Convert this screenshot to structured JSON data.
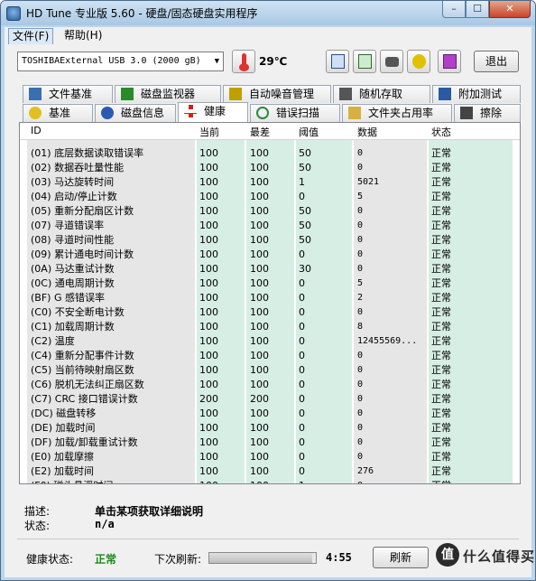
{
  "window": {
    "title": "HD Tune 专业版 5.60 - 硬盘/固态硬盘实用程序",
    "min": "–",
    "max": "☐",
    "close": "✕"
  },
  "menu": {
    "file": "文件(F)",
    "help": "帮助(H)"
  },
  "toolbar": {
    "drive": "TOSHIBAExternal USB 3.0 (2000 gB)",
    "temperature": "29℃",
    "exit": "退出",
    "icons": [
      "copy-icon",
      "copy-all-icon",
      "camera-icon",
      "tools-icon",
      "download-icon"
    ]
  },
  "tabs_row1": [
    {
      "label": "文件基准",
      "icon": "file-benchmark-icon",
      "color": "#3a6fb0"
    },
    {
      "label": "磁盘监视器",
      "icon": "disk-monitor-icon",
      "color": "#2a8a2a"
    },
    {
      "label": "自动噪音管理",
      "icon": "speaker-icon",
      "color": "#c0a000"
    },
    {
      "label": "随机存取",
      "icon": "random-access-icon",
      "color": "#555555"
    },
    {
      "label": "附加测试",
      "icon": "extra-tests-icon",
      "color": "#2a5aa0"
    }
  ],
  "tabs_row2": [
    {
      "label": "基准",
      "icon": "lightbulb-icon",
      "color": "#e0c020"
    },
    {
      "label": "磁盘信息",
      "icon": "info-icon",
      "color": "#2a5ab0"
    },
    {
      "label": "健康",
      "icon": "health-cross-icon",
      "color": "#d02020"
    },
    {
      "label": "错误扫描",
      "icon": "magnifier-icon",
      "color": "#2a8a3a"
    },
    {
      "label": "文件夹占用率",
      "icon": "folder-icon",
      "color": "#d8b040"
    },
    {
      "label": "擦除",
      "icon": "trash-icon",
      "color": "#444444"
    }
  ],
  "active_tab": "健康",
  "table": {
    "headers": {
      "id": "ID",
      "current": "当前",
      "worst": "最差",
      "threshold": "阈值",
      "data": "数据",
      "status": "状态"
    },
    "rows": [
      {
        "id": "(01) 底层数据读取错误率",
        "cur": "100",
        "worst": "100",
        "thr": "50",
        "data": "0",
        "status": "正常"
      },
      {
        "id": "(02) 数据吞吐量性能",
        "cur": "100",
        "worst": "100",
        "thr": "50",
        "data": "0",
        "status": "正常"
      },
      {
        "id": "(03) 马达旋转时间",
        "cur": "100",
        "worst": "100",
        "thr": "1",
        "data": "5021",
        "status": "正常"
      },
      {
        "id": "(04) 启动/停止计数",
        "cur": "100",
        "worst": "100",
        "thr": "0",
        "data": "5",
        "status": "正常"
      },
      {
        "id": "(05) 重新分配扇区计数",
        "cur": "100",
        "worst": "100",
        "thr": "50",
        "data": "0",
        "status": "正常"
      },
      {
        "id": "(07) 寻道错误率",
        "cur": "100",
        "worst": "100",
        "thr": "50",
        "data": "0",
        "status": "正常"
      },
      {
        "id": "(08) 寻道时间性能",
        "cur": "100",
        "worst": "100",
        "thr": "50",
        "data": "0",
        "status": "正常"
      },
      {
        "id": "(09) 累计通电时间计数",
        "cur": "100",
        "worst": "100",
        "thr": "0",
        "data": "0",
        "status": "正常"
      },
      {
        "id": "(0A) 马达重试计数",
        "cur": "100",
        "worst": "100",
        "thr": "30",
        "data": "0",
        "status": "正常"
      },
      {
        "id": "(0C) 通电周期计数",
        "cur": "100",
        "worst": "100",
        "thr": "0",
        "data": "5",
        "status": "正常"
      },
      {
        "id": "(BF) G 感错误率",
        "cur": "100",
        "worst": "100",
        "thr": "0",
        "data": "2",
        "status": "正常"
      },
      {
        "id": "(C0) 不安全断电计数",
        "cur": "100",
        "worst": "100",
        "thr": "0",
        "data": "0",
        "status": "正常"
      },
      {
        "id": "(C1) 加载周期计数",
        "cur": "100",
        "worst": "100",
        "thr": "0",
        "data": "8",
        "status": "正常"
      },
      {
        "id": "(C2) 温度",
        "cur": "100",
        "worst": "100",
        "thr": "0",
        "data": "12455569...",
        "status": "正常"
      },
      {
        "id": "(C4) 重新分配事件计数",
        "cur": "100",
        "worst": "100",
        "thr": "0",
        "data": "0",
        "status": "正常"
      },
      {
        "id": "(C5) 当前待映射扇区数",
        "cur": "100",
        "worst": "100",
        "thr": "0",
        "data": "0",
        "status": "正常"
      },
      {
        "id": "(C6) 脱机无法纠正扇区数",
        "cur": "100",
        "worst": "100",
        "thr": "0",
        "data": "0",
        "status": "正常"
      },
      {
        "id": "(C7) CRC 接口错误计数",
        "cur": "200",
        "worst": "200",
        "thr": "0",
        "data": "0",
        "status": "正常"
      },
      {
        "id": "(DC) 磁盘转移",
        "cur": "100",
        "worst": "100",
        "thr": "0",
        "data": "0",
        "status": "正常"
      },
      {
        "id": "(DE) 加载时间",
        "cur": "100",
        "worst": "100",
        "thr": "0",
        "data": "0",
        "status": "正常"
      },
      {
        "id": "(DF) 加载/卸载重试计数",
        "cur": "100",
        "worst": "100",
        "thr": "0",
        "data": "0",
        "status": "正常"
      },
      {
        "id": "(E0) 加载摩擦",
        "cur": "100",
        "worst": "100",
        "thr": "0",
        "data": "0",
        "status": "正常"
      },
      {
        "id": "(E2) 加载时间",
        "cur": "100",
        "worst": "100",
        "thr": "0",
        "data": "276",
        "status": "正常"
      },
      {
        "id": "(F0) 磁头悬浮时间",
        "cur": "100",
        "worst": "100",
        "thr": "1",
        "data": "0",
        "status": "正常"
      }
    ]
  },
  "details": {
    "desc_label": "描述:",
    "desc_value": "单击某项获取详细说明",
    "status_label": "状态:",
    "status_value": "n/a"
  },
  "footer": {
    "health_label": "健康状态:",
    "health_value": "正常",
    "refresh_label": "下次刷新:",
    "refresh_progress": 0.97,
    "countdown": "4:55",
    "refresh_button": "刷新",
    "watermark_badge": "值",
    "watermark_text": "什么值得买"
  }
}
